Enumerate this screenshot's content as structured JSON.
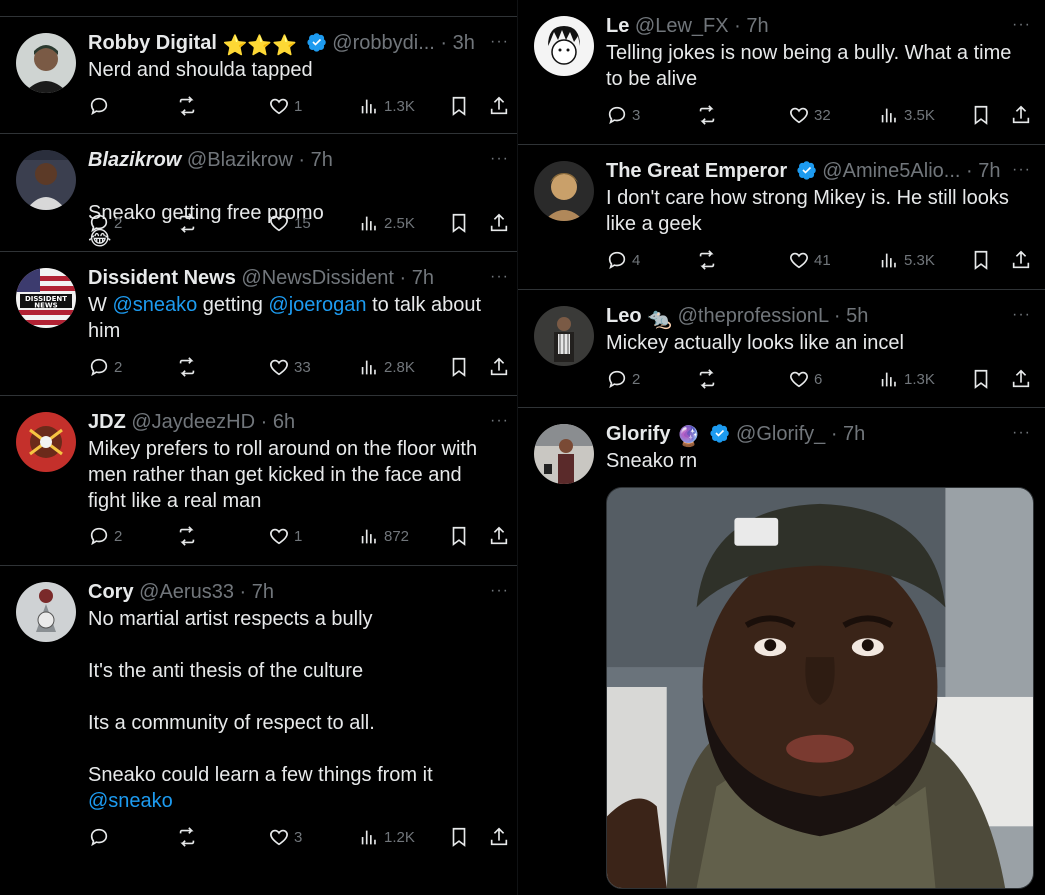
{
  "left_column": [
    {
      "name": "Robby Digital",
      "name_emoji": "⭐⭐⭐",
      "verified": true,
      "handle": "@robbydi...",
      "time": "3h",
      "body": "Nerd and shoulda tapped",
      "replies": "",
      "likes": "1",
      "views": "1.3K"
    },
    {
      "name": "Blazikrow",
      "verified": false,
      "handle": "@Blazikrow",
      "time": "7h",
      "body": "Sneako getting free promo",
      "body_emoji": "😂",
      "replies": "2",
      "likes": "15",
      "views": "2.5K"
    },
    {
      "name": "Dissident News",
      "verified": false,
      "handle": "@NewsDissident",
      "time": "7h",
      "body_pre": "W ",
      "mention1": "@sneako",
      "body_mid": " getting ",
      "mention2": "@joerogan",
      "body_post": " to talk about him",
      "avatar_text": [
        "DISSIDENT",
        "NEWS"
      ],
      "replies": "2",
      "likes": "33",
      "views": "2.8K"
    },
    {
      "name": "JDZ",
      "verified": false,
      "handle": "@JaydeezHD",
      "time": "6h",
      "body": "Mikey prefers to roll around on the floor with men rather than get kicked in the face and fight like a real man",
      "replies": "2",
      "likes": "1",
      "views": "872"
    },
    {
      "name": "Cory",
      "verified": false,
      "handle": "@Aerus33",
      "time": "7h",
      "body_lines": [
        "No martial artist respects a bully",
        "",
        "It's the anti thesis of the culture",
        "",
        "Its a community of respect to all.",
        "",
        "Sneako could learn a few things from it"
      ],
      "mention_end": "@sneako",
      "replies": "",
      "likes": "3",
      "views": "1.2K"
    }
  ],
  "right_column": [
    {
      "name": "Le",
      "verified": false,
      "handle": "@Lew_FX",
      "time": "7h",
      "body": "Telling jokes is now being a bully. What a time to be alive",
      "replies": "3",
      "likes": "32",
      "views": "3.5K"
    },
    {
      "name": "The Great Emperor",
      "verified": true,
      "handle": "@Amine5Alio...",
      "time": "7h",
      "body": "I don't care how strong Mikey is. He still looks like a geek",
      "replies": "4",
      "likes": "41",
      "views": "5.3K"
    },
    {
      "name": "Leo",
      "name_emoji": "🐀",
      "verified": false,
      "handle": "@theprofessionL",
      "time": "5h",
      "body": "Mickey actually looks like an incel",
      "replies": "2",
      "likes": "6",
      "views": "1.3K"
    },
    {
      "name": "Glorify",
      "name_emoji": "🔮",
      "verified": true,
      "handle": "@Glorify_",
      "time": "7h",
      "body": "Sneako rn"
    }
  ],
  "colors": {
    "background": "#000000",
    "text": "#e7e9ea",
    "muted": "#71767b",
    "accent": "#1d9bf0",
    "border": "#2f3336"
  },
  "icons": [
    "reply-icon",
    "retweet-icon",
    "like-icon",
    "views-icon",
    "bookmark-icon",
    "share-icon",
    "verified-badge-icon",
    "more-icon"
  ]
}
